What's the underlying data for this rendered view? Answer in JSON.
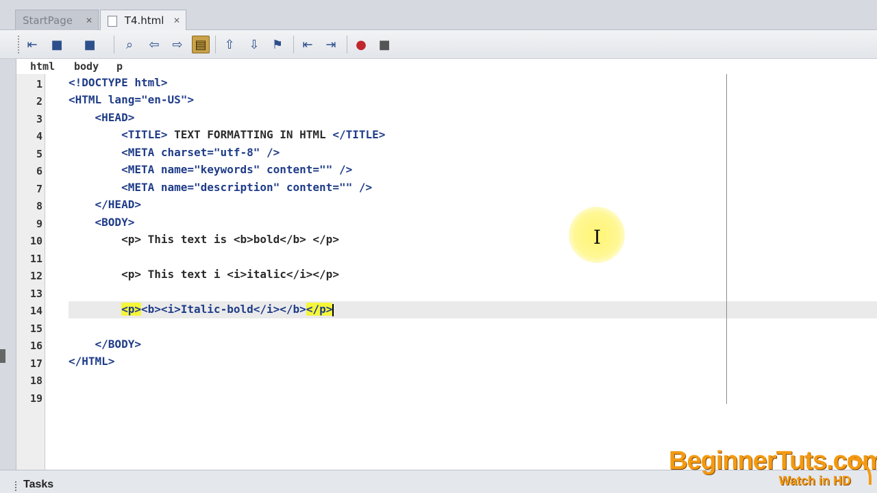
{
  "tabs": [
    {
      "label": "StartPage",
      "active": false
    },
    {
      "label": "T4.html",
      "active": true
    }
  ],
  "toolbar": {
    "icons": [
      "back-icon",
      "forward-icon",
      "search-icon",
      "find-prev-icon",
      "find-next-icon",
      "toggle-highlight-icon",
      "prev-bookmark-icon",
      "next-bookmark-icon",
      "toggle-bookmark-icon",
      "shift-left-icon",
      "shift-right-icon",
      "record-macro-icon",
      "stop-macro-icon"
    ]
  },
  "breadcrumb": [
    "html",
    "body",
    "p"
  ],
  "line_numbers": [
    "1",
    "2",
    "3",
    "4",
    "5",
    "6",
    "7",
    "8",
    "9",
    "10",
    "11",
    "12",
    "13",
    "14",
    "15",
    "16",
    "17",
    "18",
    "19"
  ],
  "code": {
    "l1": "<!DOCTYPE html>",
    "l2": "<HTML lang=\"en-US\">",
    "l3": "    <HEAD>",
    "l4a": "        <TITLE>",
    "l4b": " TEXT FORMATTING IN HTML ",
    "l4c": "</TITLE>",
    "l5": "        <META charset=\"utf-8\" />",
    "l6": "        <META name=\"keywords\" content=\"\" />",
    "l7": "        <META name=\"description\" content=\"\" />",
    "l8": "    </HEAD>",
    "l9": "    <BODY>",
    "l10": "        <p> This text is <b>bold</b> </p>",
    "l12": "        <p> This text i <i>italic</i></p>",
    "l14_indent": "        ",
    "l14_open": "<p>",
    "l14_mid": "<b><i>Italic-bold</i></b>",
    "l14_close": "</p>",
    "l16": "    </BODY>",
    "l17": "</HTML>"
  },
  "tasks": {
    "label": "Tasks"
  },
  "watermark": {
    "main": "BeginnerTuts.com",
    "sub": "Watch in HD"
  }
}
